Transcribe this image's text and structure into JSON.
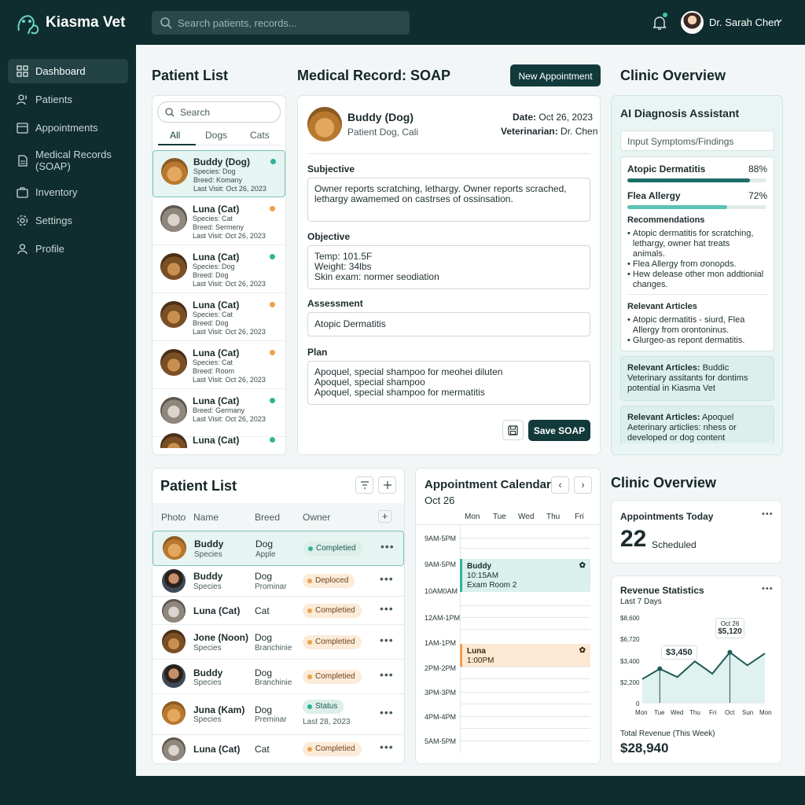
{
  "app": {
    "name": "Kiasma Vet"
  },
  "search": {
    "placeholder": "Search patients, records..."
  },
  "user": {
    "name": "Dr. Sarah Chen"
  },
  "sidebar": {
    "items": [
      {
        "label": "Dashboard",
        "icon": "grid-icon",
        "active": true
      },
      {
        "label": "Patients",
        "icon": "users-icon"
      },
      {
        "label": "Appointments",
        "icon": "calendar-icon"
      },
      {
        "label": "Medical Records\n(SOAP)",
        "icon": "document-icon"
      },
      {
        "label": "Inventory",
        "icon": "box-icon"
      },
      {
        "label": "Settings",
        "icon": "gear-icon"
      },
      {
        "label": "Profile",
        "icon": "person-icon"
      }
    ]
  },
  "patient_list": {
    "title": "Patient List",
    "search_placeholder": "Search",
    "tabs": [
      "All",
      "Dogs",
      "Cats"
    ],
    "patients": [
      {
        "name": "Buddy (Dog)",
        "lines": [
          "Species: Dog",
          "Breed: Komany",
          "Last Visit: Oct 26, 2023"
        ],
        "status_color": "#2fb39b"
      },
      {
        "name": "Luna (Cat)",
        "lines": [
          "Species: Cat",
          "Breed: Sermeny",
          "Last Visit: Oct 26, 2023"
        ],
        "status_color": "#f0a04a"
      },
      {
        "name": "Luna (Cat)",
        "lines": [
          "Species: Dog",
          "Breed: Dog",
          "Last Visit: Oct 26, 2023"
        ],
        "status_color": "#2fb39b"
      },
      {
        "name": "Luna (Cat)",
        "lines": [
          "Species: Cat",
          "Breed: Dog",
          "Last Visit: Oct 26, 2023"
        ],
        "status_color": "#f0a04a"
      },
      {
        "name": "Luna (Cat)",
        "lines": [
          "Species: Cat",
          "Breed: Room",
          "Last Visit: Oct 26, 2023"
        ],
        "status_color": "#f0a04a"
      },
      {
        "name": "Luna (Cat)",
        "lines": [
          "Breed: Germany",
          "Last Visit: Oct 26, 2023"
        ],
        "status_color": "#2fb39b"
      },
      {
        "name": "Luna (Cat)",
        "lines": [],
        "status_color": "#2fb39b"
      }
    ]
  },
  "soap": {
    "title": "Medical Record: SOAP",
    "new_appointment": "New Appointment",
    "patient_name": "Buddy (Dog)",
    "patient_sub": "Patient Dog, Cali",
    "date_label": "Date:",
    "date": "Oct 26, 2023",
    "vet_label": "Veterinarian:",
    "vet": "Dr. Chen",
    "subjective_label": "Subjective",
    "subjective": "Owner reports scratching, lethargy. Owner reports scrached,\nlethargy awamemed on castrses of ossinsation.",
    "objective_label": "Objective",
    "objective": "Temp: 101.5F\nWeight: 34lbs\nSkin exam: normer seodiation",
    "assessment_label": "Assessment",
    "assessment": "Atopic Dermatitis",
    "plan_label": "Plan",
    "plan": "Apoquel, special shampoo for meohei diluten\nApoquel, special shampoo\nApoquel, special shampoo for mermatitis",
    "save": "Save SOAP"
  },
  "clinic_overview": {
    "title": "Clinic Overview"
  },
  "ai": {
    "title": "AI Diagnosis Assistant",
    "input_placeholder": "Input Symptoms/Findings",
    "diagnoses": [
      {
        "name": "Atopic Dermatitis",
        "pct_label": "88%",
        "pct": 0.88
      },
      {
        "name": "Flea Allergy",
        "pct_label": "72%",
        "pct": 0.72
      }
    ],
    "recommendations_title": "Recommendations",
    "recommendations": [
      "Atopic dermatitis for scratching,\nlethargy, owner hat treats\nanimals.",
      "Flea Allergy from σonoρds.",
      "Hew delease other mon addtionial\nchanges."
    ],
    "articles_title": "Relevant Articles",
    "articles": [
      "Atopic dermatitis - siurd, Flea\nAllergy from orontoninus.",
      "Glurgeo-as repont dermatitis."
    ],
    "card1_title": "Relevant Articles:",
    "card1_text": " Buddic Veterinary assitants for dontims potential in Kiasma Vet",
    "card2_title": "Relevant Articles:",
    "card2_text": " Apoquel Aeterinary articlies: nhess or developed or dog content"
  },
  "table": {
    "title": "Patient List",
    "headers": [
      "Photo",
      "Name",
      "Breed",
      "Owner"
    ],
    "rows": [
      {
        "name": "Buddy",
        "sub": "Species",
        "breed": "Dog",
        "breed2": "Apple",
        "status": "Completied",
        "tone": "green"
      },
      {
        "name": "Buddy",
        "sub": "Species",
        "breed": "Dog",
        "breed2": "Prominar",
        "status": "Deploced",
        "tone": "orange"
      },
      {
        "name": "Luna (Cat)",
        "sub": "",
        "breed": "Cat",
        "breed2": "",
        "status": "Completied",
        "tone": "orange"
      },
      {
        "name": "Jone (Noon)",
        "sub": "Species",
        "breed": "Dog",
        "breed2": "Branchinie",
        "status": "Completied",
        "tone": "orange"
      },
      {
        "name": "Buddy",
        "sub": "Species",
        "breed": "Dog",
        "breed2": "Branchinie",
        "status": "Completied",
        "tone": "orange"
      },
      {
        "name": "Juna (Kam)",
        "sub": "Species",
        "breed": "Dog",
        "breed2": "Preminar",
        "status": "Status",
        "tone": "green",
        "extra": "Last 28, 2023"
      },
      {
        "name": "Luna (Cat)",
        "sub": "",
        "breed": "Cat",
        "breed2": "",
        "status": "Completied",
        "tone": "orange"
      }
    ]
  },
  "calendar": {
    "title": "Appointment Calendar",
    "date": "Oct 26",
    "days": [
      "Mon",
      "Tue",
      "Wed",
      "Thu",
      "Fri"
    ],
    "times": [
      "9AM-5PM",
      "9AM-5PM",
      "10AM0AM",
      "12AM-1PM",
      "1AM-1PM",
      "2PM-2PM",
      "3PM-3PM",
      "4PM-4PM",
      "5AM-5PM"
    ],
    "events": [
      {
        "title": "Buddy",
        "time": "10:15AM",
        "room": "Exam Room 2",
        "color": "#2fb39b"
      },
      {
        "title": "Luna",
        "time": "1:00PM",
        "room": "",
        "color": "#f0a04a"
      }
    ]
  },
  "overview2": {
    "title": "Clinic Overview",
    "appointments_title": "Appointments Today",
    "appointments_count": "22",
    "appointments_sub": "Scheduled",
    "revenue_title": "Revenue Statistics",
    "revenue_sub": "Last 7 Days",
    "total_label": "Total Revenue (This Week)",
    "total": "$28,940"
  },
  "chart_data": {
    "type": "line",
    "title": "Revenue Statistics",
    "subtitle": "Last 7 Days",
    "x": [
      "Mon",
      "Tue",
      "Wed",
      "Thu",
      "Fri",
      "Oct",
      "Sun",
      "Mon"
    ],
    "y_ticks": [
      "$8,600",
      "$6,720",
      "$3,400",
      "$2,200",
      "0"
    ],
    "values": [
      2400,
      3450,
      2600,
      4200,
      2950,
      5120,
      3800,
      5000
    ],
    "annotations": [
      {
        "label": "$3,450",
        "x": "Tue"
      },
      {
        "label": "Oct 26",
        "value_label": "$5,120",
        "x": "Oct"
      }
    ],
    "ylim": [
      0,
      8600
    ]
  }
}
